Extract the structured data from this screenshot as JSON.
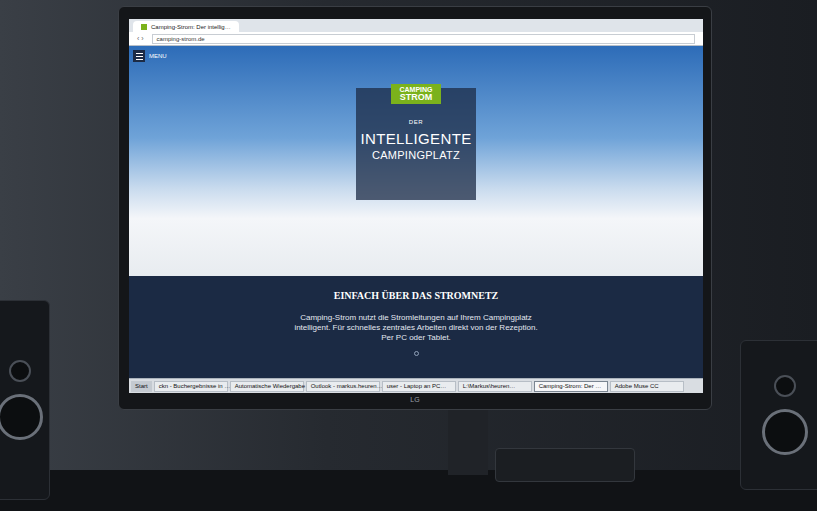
{
  "browser": {
    "tab_title": "Camping-Strom: Der intellig…",
    "url": "camping-strom.de"
  },
  "menu": {
    "label": "MENU"
  },
  "hero": {
    "logo": [
      "CAMPING",
      "STROM"
    ],
    "kicker": "DER",
    "title": [
      "INTELLIGENTE",
      "CAMPINGPLATZ"
    ]
  },
  "section": {
    "heading": "EINFACH ÜBER DAS STROMNETZ",
    "lines": [
      "Camping-Strom nutzt die Stromleitungen auf Ihrem Campingplatz",
      "intelligent. Für schnelles zentrales Arbeiten direkt von der Rezeption.",
      "Per PC oder Tablet."
    ]
  },
  "taskbar": {
    "start": "Start",
    "items": [
      {
        "label": "ckn - Buchergebnisse in …",
        "selected": false
      },
      {
        "label": "Automatische Wiedergabe",
        "selected": false
      },
      {
        "label": "Outlook - markus.heuren…",
        "selected": false
      },
      {
        "label": "user - Laptop an PC…",
        "selected": false
      },
      {
        "label": "L:\\Markus\\heuren…",
        "selected": false
      },
      {
        "label": "Camping-Strom: Der …",
        "selected": true
      },
      {
        "label": "Adobe Muse CC",
        "selected": false
      }
    ]
  },
  "monitor_brand": "LG"
}
